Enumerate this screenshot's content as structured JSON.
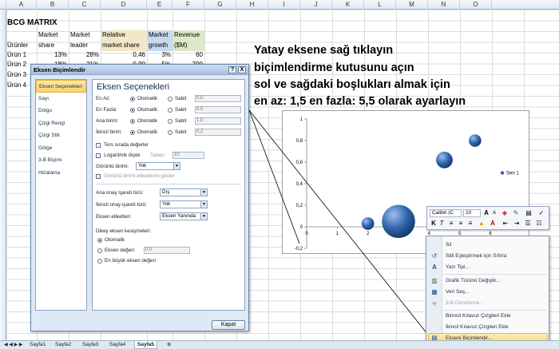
{
  "columns": [
    "A",
    "B",
    "C",
    "D",
    "E",
    "F",
    "G",
    "H",
    "I",
    "J",
    "K",
    "L",
    "M",
    "N",
    "O"
  ],
  "sheet": {
    "title": "BCG MATRIX",
    "headers": {
      "products": "Ürünler",
      "market_share": [
        "Market",
        "share"
      ],
      "market_leader": [
        "Market",
        "leader"
      ],
      "relative_share": [
        "Relative",
        "market share"
      ],
      "market_growth": [
        "Market",
        "growth"
      ],
      "revenue": [
        "Revenue",
        "($M)"
      ]
    },
    "rows": [
      {
        "name": "Ürün 1",
        "share": "13%",
        "leader": "28%",
        "relative": "0,46",
        "growth": "3%",
        "revenue": "60"
      },
      {
        "name": "Ürün 2",
        "share": "18%",
        "leader": "21%",
        "relative": "0,90",
        "growth": "5%",
        "revenue": "700"
      },
      {
        "name": "Ürün 3",
        "share": "",
        "leader": "",
        "relative": "",
        "growth": "",
        "revenue": ""
      },
      {
        "name": "Ürün 4",
        "share": "",
        "leader": "",
        "relative": "",
        "growth": "",
        "revenue": ""
      }
    ]
  },
  "annotation": [
    "Yatay eksene sağ tıklayın",
    "biçimlendirme kutusunu açın",
    "sol ve sağdaki boşlukları almak için",
    "en az: 1,5 en fazla: 5,5 olarak ayarlayın"
  ],
  "dialog": {
    "title": "Eksen Biçimlendir",
    "help": "?",
    "close": "X",
    "nav": [
      "Eksen Seçenekleri",
      "Sayı",
      "Dolgu",
      "Çizgi Rengi",
      "Çizgi Stili",
      "Gölge",
      "3-B Biçimi",
      "Hizalama"
    ],
    "section_title": "Eksen Seçenekleri",
    "auto": "Otomatik",
    "fixed": "Sabit",
    "min_label": "En Az:",
    "max_label": "En Fazla:",
    "major_label": "Ana birim:",
    "minor_label": "İkincil birim:",
    "min_value": "0,0",
    "max_value": "6,0",
    "major_value": "1,0",
    "minor_value": "0,2",
    "reverse": "Ters sırada değerler",
    "log": "Logaritmik ölçek",
    "base_label": "Taban:",
    "base_value": "10",
    "display_units_label": "Görüntü birimi:",
    "display_units_value": "Yok",
    "show_units": "Görüntü birimi etiketlerini göster",
    "major_tick_label": "Ana onay işareti türü:",
    "major_tick_value": "Dış",
    "minor_tick_label": "İkincil onay işareti türü:",
    "minor_tick_value": "Yok",
    "axis_labels_label": "Eksen etiketleri:",
    "axis_labels_value": "Eksen Yanında",
    "cross_title": "Dikey eksen kesişmeleri:",
    "cross_auto": "Otomatik",
    "cross_value_label": "Eksen değeri:",
    "cross_value": "0,0",
    "cross_max": "En büyük eksen değeri",
    "close_button": "Kapat"
  },
  "chart_data": {
    "type": "scatter",
    "title": "",
    "xlabel": "",
    "ylabel": "",
    "x_ticks": [
      "0",
      "1",
      "2",
      "3",
      "4",
      "5",
      "6"
    ],
    "y_ticks": [
      "-0,2",
      "0",
      "0,2",
      "0,4",
      "0,6",
      "0,8",
      "1"
    ],
    "xlim": [
      0,
      6
    ],
    "ylim": [
      -0.2,
      1.0
    ],
    "series": [
      {
        "name": "Seri 1",
        "points": [
          {
            "x": 2.0,
            "y": 0.03,
            "r": 3
          },
          {
            "x": 3.0,
            "y": 0.05,
            "r": 8
          },
          {
            "x": 4.5,
            "y": 0.62,
            "r": 4
          },
          {
            "x": 5.5,
            "y": 0.8,
            "r": 3
          }
        ]
      }
    ],
    "legend": "right",
    "bubble_color": "#2f64a8"
  },
  "mini_toolbar": {
    "font": "Calibri (C",
    "size": "10"
  },
  "context_menu": [
    {
      "label": "Sil",
      "disabled": false,
      "icon": ""
    },
    {
      "label": "Stili Eşleştirmek için Sıfırla",
      "disabled": false,
      "icon": "reset-icon"
    },
    {
      "label": "Yazı Tipi...",
      "disabled": false,
      "icon": "font-icon"
    },
    {
      "label": "Grafik Türünü Değiştir...",
      "disabled": false,
      "icon": "chart-type-icon"
    },
    {
      "label": "Veri Seç...",
      "disabled": false,
      "icon": "data-icon"
    },
    {
      "label": "3-B Döndürme...",
      "disabled": true,
      "icon": "rotate-icon"
    },
    {
      "label": "Birincil Kılavuz Çizgileri Ekle",
      "disabled": false,
      "icon": ""
    },
    {
      "label": "İkincil Kılavuz Çizgileri Ekle",
      "disabled": false,
      "icon": ""
    },
    {
      "label": "Ekseni Biçimlendir...",
      "disabled": false,
      "icon": "format-axis-icon",
      "highlight": true
    }
  ],
  "tabs": [
    "Sayfa1",
    "Sayfa2",
    "Sayfa3",
    "Sayfa4",
    "Sayfa5"
  ],
  "active_tab": "Sayfa5"
}
